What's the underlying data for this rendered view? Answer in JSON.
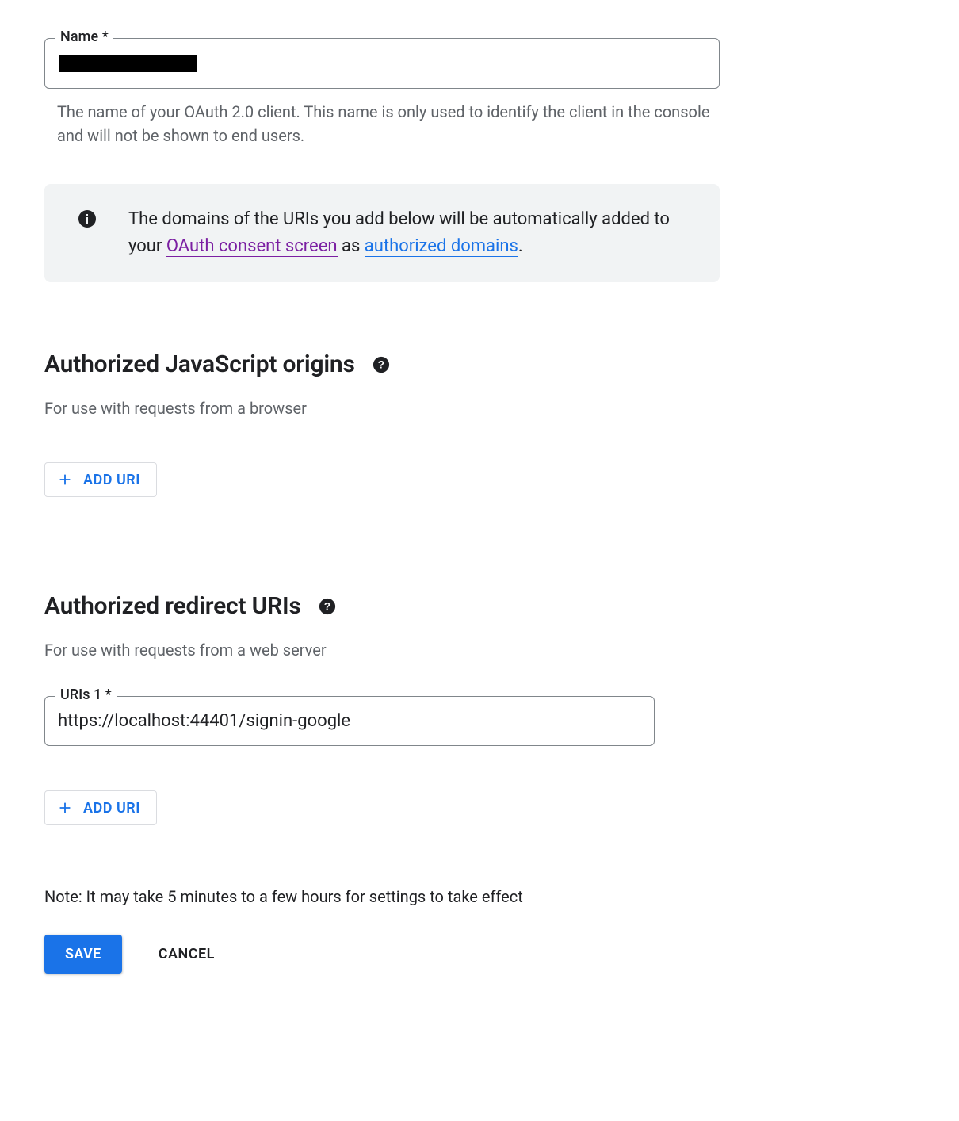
{
  "name_field": {
    "label": "Name *",
    "value": "",
    "helper": "The name of your OAuth 2.0 client. This name is only used to identify the client in the console and will not be shown to end users."
  },
  "info_banner": {
    "prefix": "The domains of the URIs you add below will be automatically added to your ",
    "link1_text": "OAuth consent screen",
    "middle": " as ",
    "link2_text": "authorized domains",
    "suffix": "."
  },
  "js_origins": {
    "heading": "Authorized JavaScript origins",
    "sub": "For use with requests from a browser",
    "add_label": "ADD URI"
  },
  "redirect_uris": {
    "heading": "Authorized redirect URIs",
    "sub": "For use with requests from a web server",
    "uri1_label": "URIs 1 *",
    "uri1_value": "https://localhost:44401/signin-google",
    "add_label": "ADD URI"
  },
  "note": "Note: It may take 5 minutes to a few hours for settings to take effect",
  "buttons": {
    "save": "SAVE",
    "cancel": "CANCEL"
  }
}
